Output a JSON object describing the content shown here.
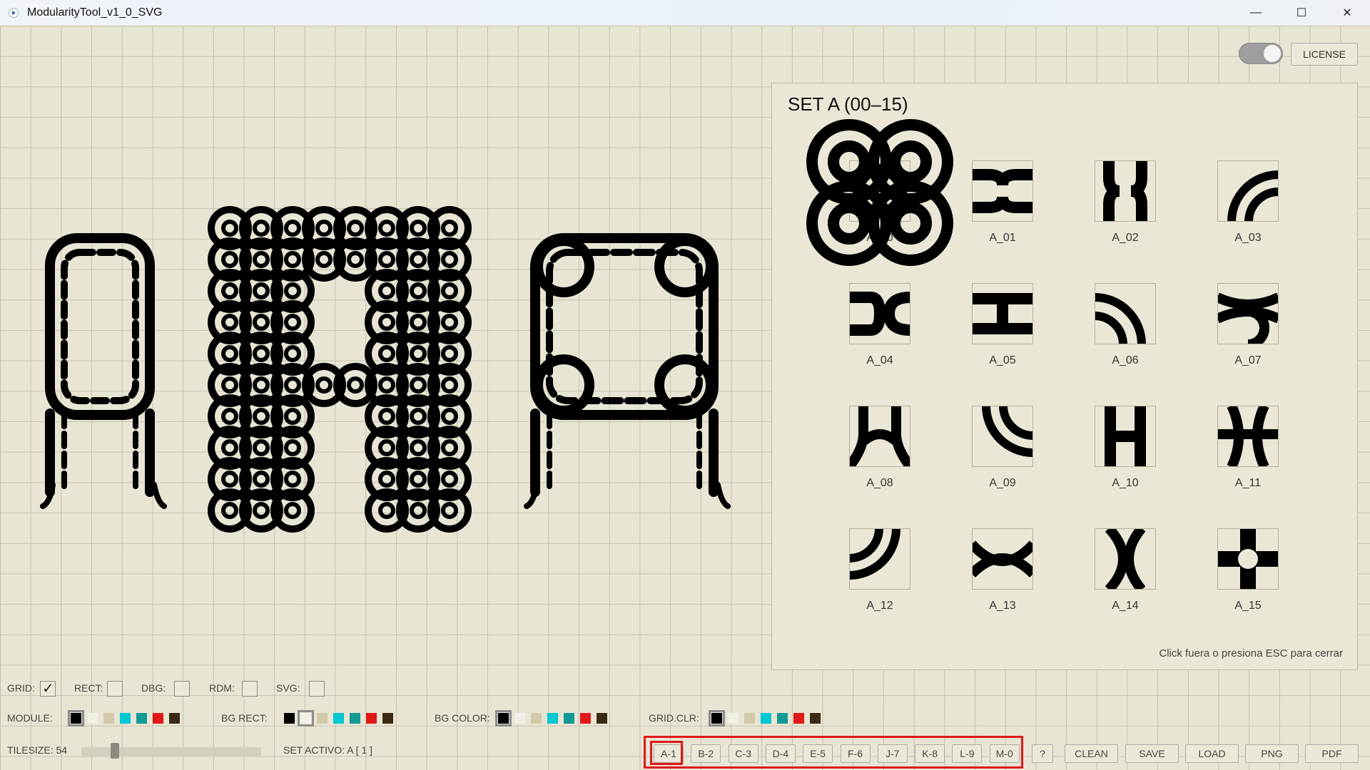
{
  "window": {
    "title": "ModularityTool_v1_0_SVG",
    "minimize": "—",
    "maximize": "☐",
    "close": "✕"
  },
  "top_right": {
    "license_label": "LICENSE"
  },
  "panel": {
    "title": "SET A  (00–15)",
    "hint": "Click fuera o presiona ESC para cerrar",
    "tiles": [
      "A_00",
      "A_01",
      "A_02",
      "A_03",
      "A_04",
      "A_05",
      "A_06",
      "A_07",
      "A_08",
      "A_09",
      "A_10",
      "A_11",
      "A_12",
      "A_13",
      "A_14",
      "A_15"
    ]
  },
  "toggles": {
    "grid": "GRID:",
    "rect": "RECT:",
    "dbg": "DBG:",
    "rdm": "RDM:",
    "svg": "SVG:"
  },
  "color_rows": {
    "module": "MODULE:",
    "bg_rect": "BG RECT:",
    "bg_color": "BG COLOR:",
    "grid_clr": "GRID.CLR:"
  },
  "palette": [
    "#000000",
    "#f2f0e6",
    "#d2c9a8",
    "#00c7d4",
    "#119a94",
    "#e01818",
    "#3a2a14"
  ],
  "status": {
    "tilesize": "TILESIZE: 54",
    "set_activo": "SET ACTIVO: A [ 1 ]"
  },
  "set_buttons": [
    "A-1",
    "B-2",
    "C-3",
    "D-4",
    "E-5",
    "F-6",
    "J-7",
    "K-8",
    "L-9",
    "M-0"
  ],
  "action_buttons": [
    "?",
    "CLEAN",
    "SAVE",
    "LOAD",
    "PNG",
    "PDF"
  ]
}
